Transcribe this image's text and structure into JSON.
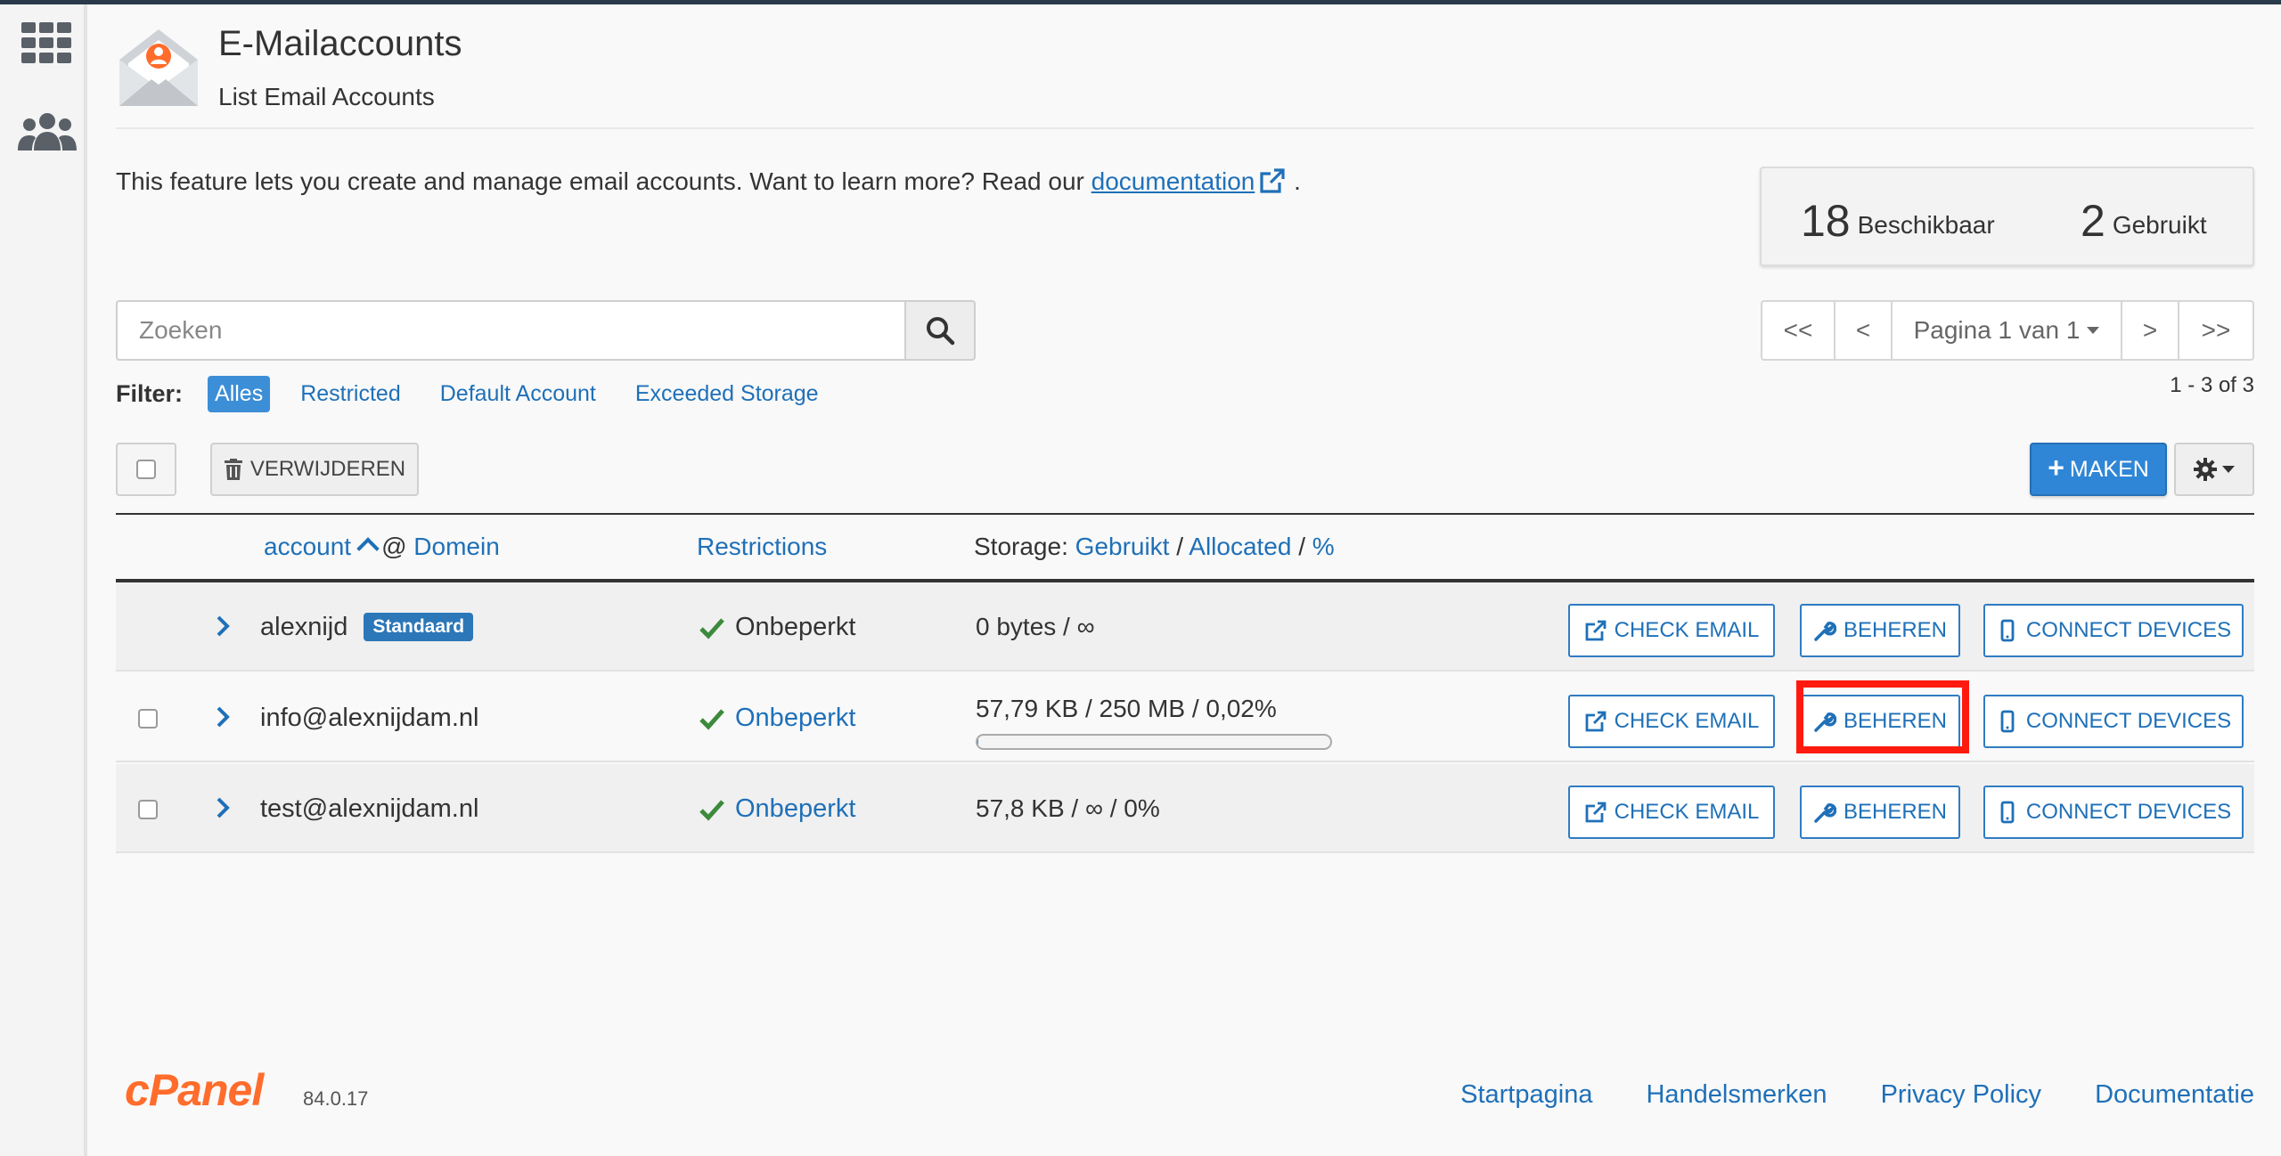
{
  "header": {
    "title": "E-Mailaccounts",
    "subtitle": "List Email Accounts"
  },
  "intro": {
    "text": "This feature lets you create and manage email accounts. Want to learn more? Read our ",
    "link_label": "documentation",
    "suffix": "."
  },
  "stats": {
    "available_count": "18",
    "available_label": "Beschikbaar",
    "used_count": "2",
    "used_label": "Gebruikt"
  },
  "search": {
    "placeholder": "Zoeken"
  },
  "filter": {
    "label": "Filter:",
    "options": [
      "Alles",
      "Restricted",
      "Default Account",
      "Exceeded Storage"
    ],
    "active": "Alles"
  },
  "pager": {
    "first": "<<",
    "prev": "<",
    "page_label": "Pagina 1 van 1",
    "next": ">",
    "last": ">>",
    "range": "1 - 3 of 3"
  },
  "toolbar": {
    "delete_label": "VERWIJDEREN",
    "make_label": "MAKEN"
  },
  "columns": {
    "account": "account",
    "at": "@",
    "domain": "Domein",
    "restrictions": "Restrictions",
    "storage_prefix": "Storage:",
    "storage_used": "Gebruikt",
    "storage_sep": "/",
    "storage_allocated": "Allocated",
    "storage_pct": "%"
  },
  "rows": [
    {
      "account": "alexnijd",
      "badge": "Standaard",
      "restriction": "Onbeperkt",
      "storage": "0 bytes / ∞",
      "progress": null
    },
    {
      "account": "info@alexnijdam.nl",
      "badge": "",
      "restriction": "Onbeperkt",
      "storage": "57,79 KB / 250 MB / 0,02%",
      "progress": 0.0002
    },
    {
      "account": "test@alexnijdam.nl",
      "badge": "",
      "restriction": "Onbeperkt",
      "storage": "57,8 KB / ∞ / 0%",
      "progress": null
    }
  ],
  "actions": {
    "check_email": "CHECK EMAIL",
    "manage": "BEHEREN",
    "connect": "CONNECT DEVICES"
  },
  "footer": {
    "logo": "cPanel",
    "version": "84.0.17",
    "links": [
      "Startpagina",
      "Handelsmerken",
      "Privacy Policy",
      "Documentatie"
    ]
  },
  "colors": {
    "accent": "#1f70b8",
    "primary_button": "#2f86d6",
    "success": "#3c8a3c",
    "highlight": "#ff1a10",
    "brand": "#ff6c2c"
  }
}
